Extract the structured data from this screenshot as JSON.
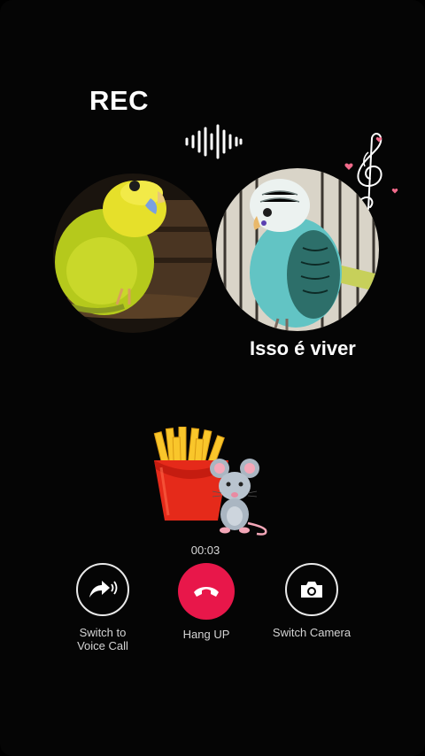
{
  "header": {
    "rec_label": "REC"
  },
  "call": {
    "caption": "Isso é viver",
    "timer": "00:03"
  },
  "controls": [
    {
      "label": "Switch to\nVoice Call",
      "icon": "share-forward-icon"
    },
    {
      "label": "Hang UP",
      "icon": "phone-hangup-icon",
      "color": "#e8174a"
    },
    {
      "label": "Switch Camera",
      "icon": "camera-icon"
    }
  ],
  "stickers": [
    "french-fries-icon",
    "mouse-icon",
    "music-note-icon"
  ]
}
